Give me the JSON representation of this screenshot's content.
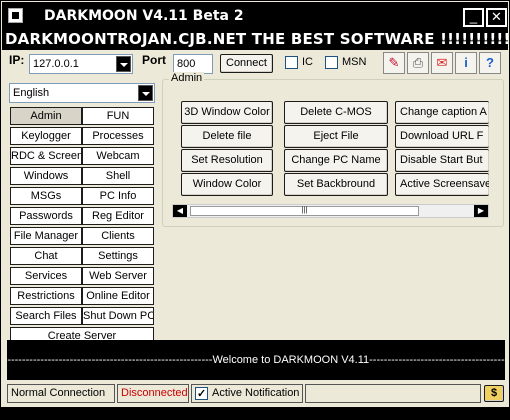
{
  "window": {
    "title": "DARKMOON V4.11 Beta 2",
    "min_glyph": "_",
    "close_glyph": "✕"
  },
  "banner": "DARKMOONTROJAN.CJB.NET THE BEST SOFTWARE !!!!!!!!!!!!!!!!!!",
  "connection": {
    "ip_label": "IP:",
    "ip_value": "127.0.0.1",
    "port_label": "Port",
    "port_value": "800",
    "connect_label": "Connect",
    "ic_label": "IC",
    "msn_label": "MSN"
  },
  "toolbar_icons": [
    "pencils-icon",
    "printer-icon",
    "mail-icon",
    "info-icon",
    "help-icon"
  ],
  "language": "English",
  "sidebar": {
    "rows": [
      [
        "Admin",
        "FUN"
      ],
      [
        "Keylogger",
        "Processes"
      ],
      [
        "RDC & Screen",
        "Webcam"
      ],
      [
        "Windows",
        "Shell"
      ],
      [
        "MSGs",
        "PC Info"
      ],
      [
        "Passwords",
        "Reg Editor"
      ],
      [
        "File Manager",
        "Clients"
      ],
      [
        "Chat",
        "Settings"
      ],
      [
        "Services",
        "Web Server"
      ],
      [
        "Restrictions",
        "Online Editor"
      ],
      [
        "Search Files",
        "Shut Down PC"
      ]
    ],
    "create_server": "Create Server",
    "selected": "Admin"
  },
  "admin_panel": {
    "caption": "Admin",
    "col1": [
      "3D Window Color",
      "Delete file",
      "Set Resolution",
      "Window Color"
    ],
    "col2": [
      "Delete C-MOS",
      "Eject File",
      "Change PC Name",
      "Set Backbround"
    ],
    "col3": [
      "Change caption  A",
      "Download URL F",
      "Disable Start But",
      "Active Screensave"
    ]
  },
  "log": "--------------------------------------------------------Welcome to DARKMOON V4.11----------------------------------------------------------",
  "statusbar": {
    "connection_type": "Normal Connection",
    "state": "Disconnected",
    "state_color": "#cc0000",
    "notification_label": "Active Notification",
    "dollar": "$"
  }
}
